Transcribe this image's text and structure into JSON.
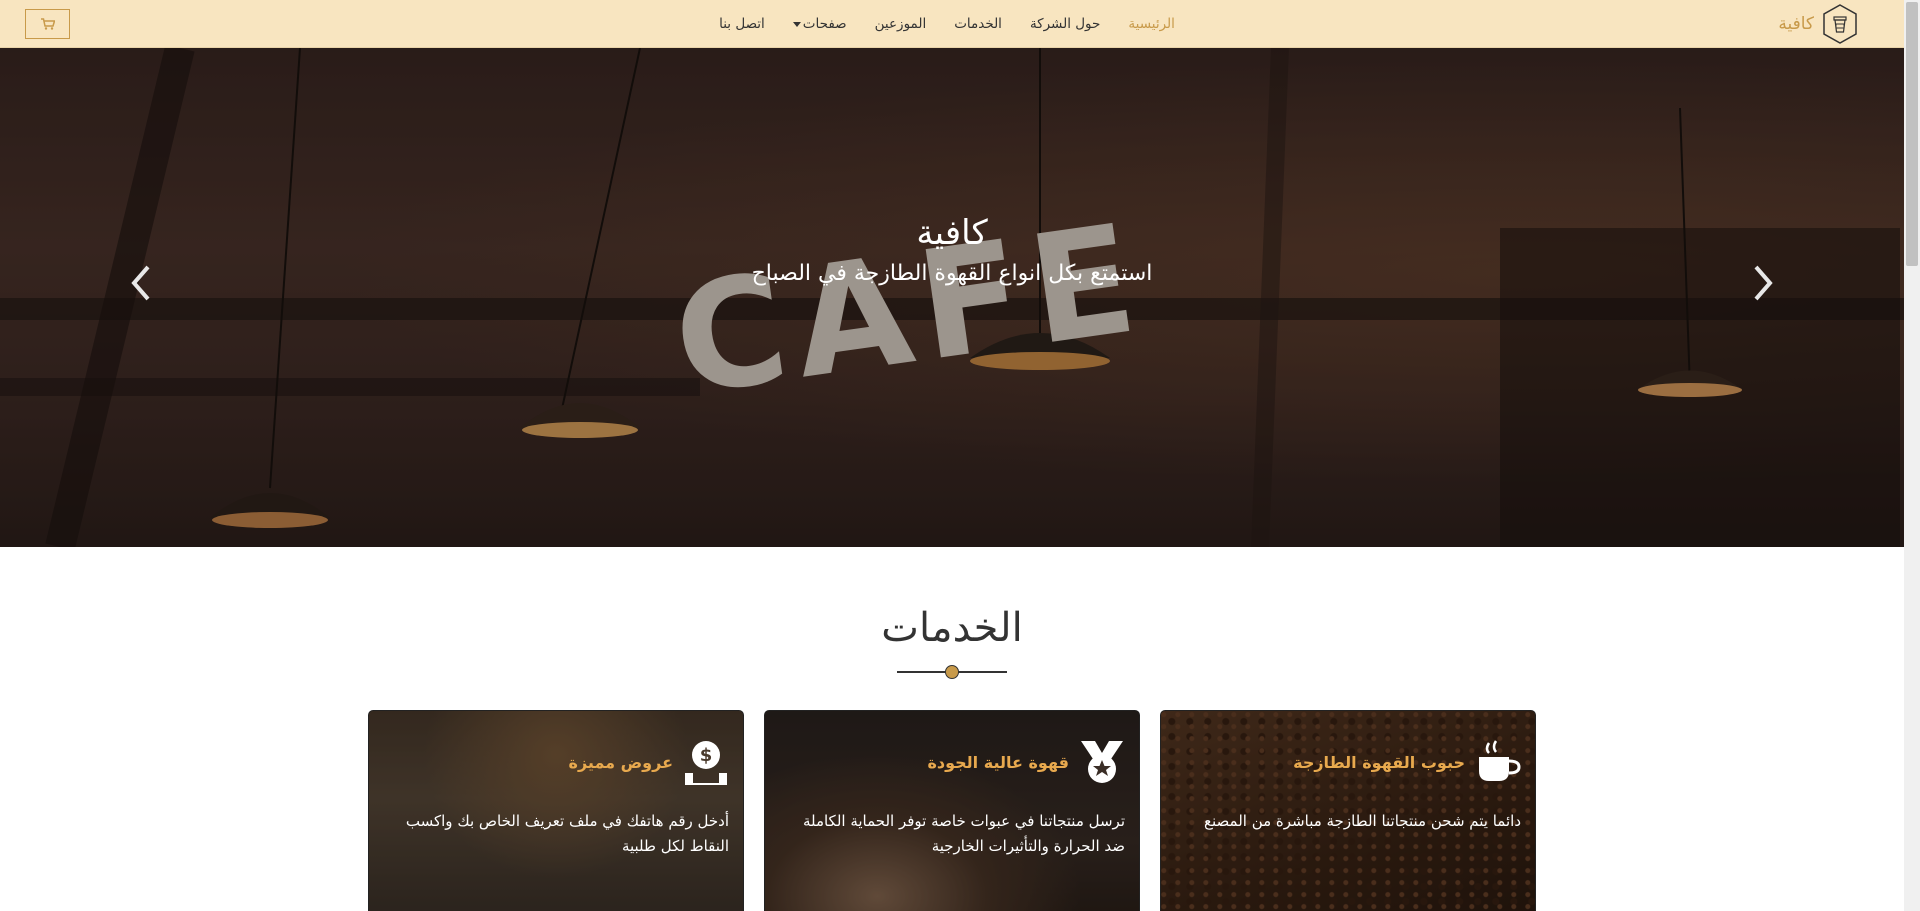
{
  "brand": {
    "name": "كافية",
    "logo_icon": "cup-hexagon-logo-icon"
  },
  "nav": {
    "items": [
      {
        "label": "الرئيسية",
        "active": true
      },
      {
        "label": "حول الشركة",
        "active": false
      },
      {
        "label": "الخدمات",
        "active": false
      },
      {
        "label": "الموزعين",
        "active": false
      },
      {
        "label": "صفحات",
        "active": false,
        "dropdown": true
      },
      {
        "label": "اتصل بنا",
        "active": false
      }
    ],
    "cart_icon": "cart-icon"
  },
  "hero": {
    "title": "كافية",
    "subtitle": "استمتع بكل انواع القهوة الطازجة في الصباح",
    "sign_text": "CAFE",
    "prev_icon": "chevron-left-icon",
    "next_icon": "chevron-right-icon"
  },
  "services": {
    "title": "الخدمات",
    "cards": [
      {
        "title": "حبوب القهوة الطازجة",
        "icon": "coffee-cup-icon",
        "text": "دائما يتم شحن منتجاتنا الطازجة مباشرة من المصنع"
      },
      {
        "title": "قهوة عالية الجودة",
        "icon": "medal-star-icon",
        "text": "ترسل منتجاتنا في عبوات خاصة توفر الحماية الكاملة ضد الحرارة والتأثيرات الخارجية"
      },
      {
        "title": "عروض مميزة",
        "icon": "coin-hand-icon",
        "text": "أدخل رقم هاتفك في ملف تعريف الخاص بك واكسب النقاط لكل طلبية"
      }
    ]
  },
  "colors": {
    "accent": "#c89a4a",
    "navbar_bg": "#f8e5c0",
    "card_title": "#e8a94e"
  }
}
